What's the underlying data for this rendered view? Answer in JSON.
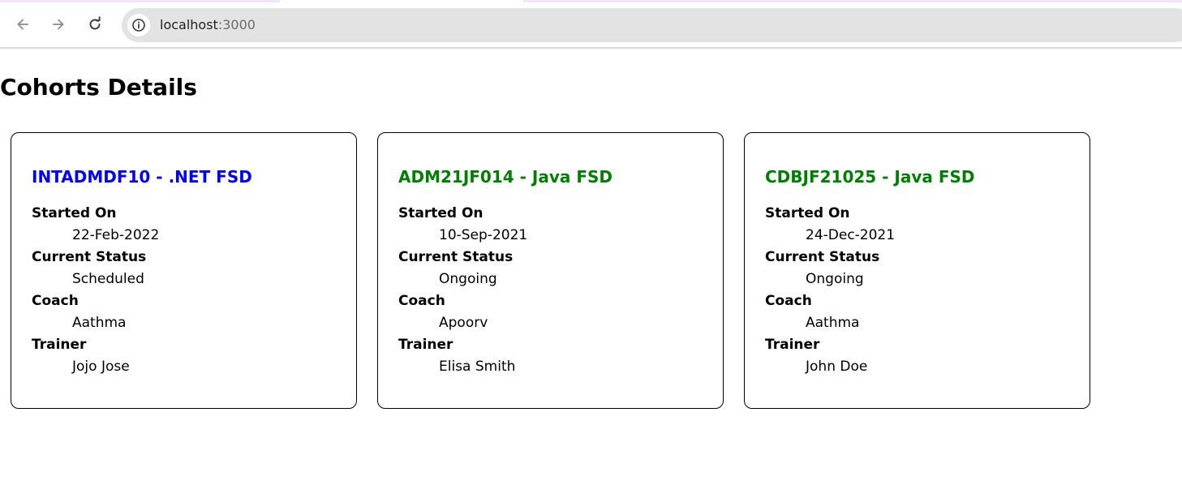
{
  "browser": {
    "url_host": "localhost",
    "url_port": ":3000",
    "icons": {
      "back": "arrow-left",
      "forward": "arrow-right",
      "reload": "reload",
      "site_info": "info-circle"
    }
  },
  "page": {
    "title": "Cohorts Details"
  },
  "labels": {
    "started_on": "Started On",
    "current_status": "Current Status",
    "coach": "Coach",
    "trainer": "Trainer"
  },
  "colors": {
    "scheduled_title": "#0000ff",
    "ongoing_title": "#008000"
  },
  "cohorts": [
    {
      "title": "INTADMDF10 - .NET FSD",
      "started_on": "22-Feb-2022",
      "current_status": "Scheduled",
      "coach": "Aathma",
      "trainer": "Jojo Jose"
    },
    {
      "title": "ADM21JF014 - Java FSD",
      "started_on": "10-Sep-2021",
      "current_status": "Ongoing",
      "coach": "Apoorv",
      "trainer": "Elisa Smith"
    },
    {
      "title": "CDBJF21025 - Java FSD",
      "started_on": "24-Dec-2021",
      "current_status": "Ongoing",
      "coach": "Aathma",
      "trainer": "John Doe"
    }
  ]
}
